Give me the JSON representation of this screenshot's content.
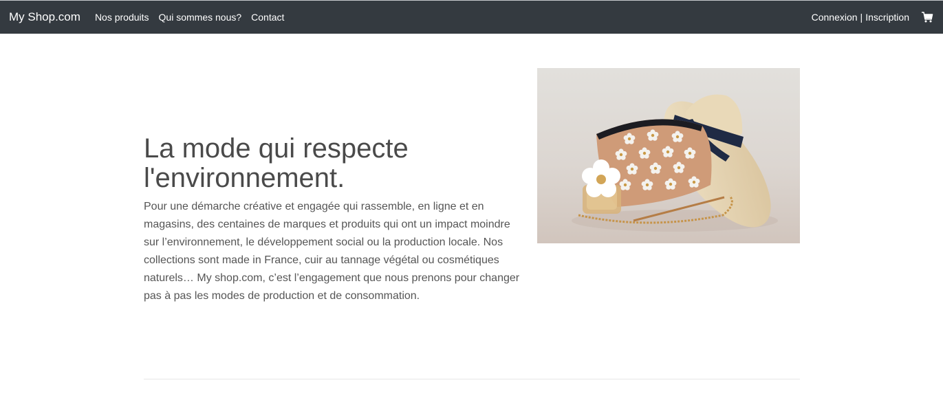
{
  "navbar": {
    "brand": "My Shop.com",
    "links": [
      "Nos produits",
      "Qui sommes nous?",
      "Contact"
    ],
    "login": "Connexion",
    "separator": "|",
    "register": "Inscription",
    "cart_icon": "cart-icon"
  },
  "hero": {
    "title": "La mode qui respecte l'environnement.",
    "text": "Pour une démarche créative et engagée qui rassemble, en ligne et en magasins, des centaines de marques et produits qui ont un impact moindre sur l’environnement, le développement social ou la production locale. Nos collections sont made in France, cuir au tannage végétal ou cosmétiques naturels… My shop.com, c’est l’engagement que nous prenons pour changer pas à pas les modes de production et de consommation."
  },
  "colors": {
    "navbar_bg": "#343a40",
    "text": "#555555",
    "title": "#4a4a4a"
  }
}
